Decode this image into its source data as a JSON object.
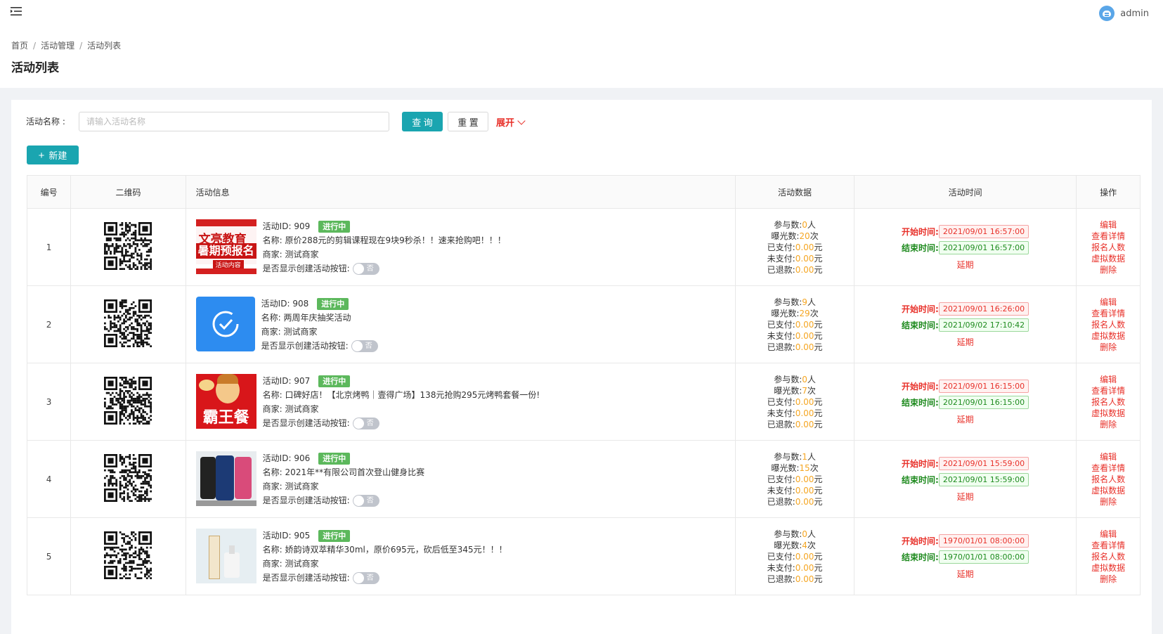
{
  "header": {
    "menu_icon": "menu-fold-icon",
    "user": "admin"
  },
  "breadcrumb": [
    "首页",
    "活动管理",
    "活动列表"
  ],
  "page_title": "活动列表",
  "filter": {
    "label": "活动名称",
    "colon": ":",
    "placeholder": "请输入活动名称",
    "query_label": "查 询",
    "reset_label": "重 置",
    "expand_label": "展开"
  },
  "new_button_label": "新建",
  "table": {
    "headers": [
      "编号",
      "二维码",
      "活动信息",
      "活动数据",
      "活动时间",
      "操作"
    ],
    "labels": {
      "id": "活动ID:",
      "name": "名称:",
      "merchant": "商家:",
      "show_btn": "是否显示创建活动按钮:",
      "toggle_off": "否",
      "participants": "参与数:",
      "exposure": "曝光数:",
      "paid": "已支付:",
      "unpaid": "未支付:",
      "refunded": "已退款:",
      "unit_person": "人",
      "unit_times": "次",
      "unit_yuan": "元",
      "start": "开始时间:",
      "end": "结束时间:",
      "delay": "延期"
    },
    "operations": [
      "编辑",
      "查看详情",
      "报名人数",
      "虚拟数据",
      "删除"
    ],
    "rows": [
      {
        "no": "1",
        "id": "909",
        "status": "进行中",
        "name": "原价288元的剪辑课程现在9块9秒杀！！速来抢购吧！！！",
        "merchant": "测试商家",
        "participants": "0",
        "exposure": "20",
        "paid": "0.00",
        "unpaid": "0.00",
        "refunded": "0.00",
        "start": "2021/09/01 16:57:00",
        "end": "2021/09/01 16:57:00",
        "thumb_text_1": "文亮教育",
        "thumb_text_2": "暑期预报名",
        "thumb_text_3": "活动内容"
      },
      {
        "no": "2",
        "id": "908",
        "status": "进行中",
        "name": "两周年庆抽奖活动",
        "merchant": "测试商家",
        "participants": "9",
        "exposure": "29",
        "paid": "0.00",
        "unpaid": "0.00",
        "refunded": "0.00",
        "start": "2021/09/01 16:26:00",
        "end": "2021/09/02 17:10:42"
      },
      {
        "no": "3",
        "id": "907",
        "status": "进行中",
        "name": "口碑好店！【北京烤鸭｜壹得广场】138元抢购295元烤鸭套餐一份!",
        "merchant": "测试商家",
        "participants": "0",
        "exposure": "7",
        "paid": "0.00",
        "unpaid": "0.00",
        "refunded": "0.00",
        "start": "2021/09/01 16:15:00",
        "end": "2021/09/01 16:15:00",
        "thumb_text_1": "霸王餐"
      },
      {
        "no": "4",
        "id": "906",
        "status": "进行中",
        "name": "2021年**有限公司首次登山健身比赛",
        "merchant": "测试商家",
        "participants": "1",
        "exposure": "15",
        "paid": "0.00",
        "unpaid": "0.00",
        "refunded": "0.00",
        "start": "2021/09/01 15:59:00",
        "end": "2021/09/01 15:59:00"
      },
      {
        "no": "5",
        "id": "905",
        "status": "进行中",
        "name": "娇韵诗双萃精华30ml，原价695元，砍后低至345元！！！",
        "merchant": "测试商家",
        "participants": "0",
        "exposure": "4",
        "paid": "0.00",
        "unpaid": "0.00",
        "refunded": "0.00",
        "start": "1970/01/01 08:00:00",
        "end": "1970/01/01 08:00:00"
      }
    ]
  },
  "colors": {
    "accent": "#1aa5b0",
    "danger": "#e8312a",
    "success": "#5cb85c",
    "value": "#f5a623"
  }
}
